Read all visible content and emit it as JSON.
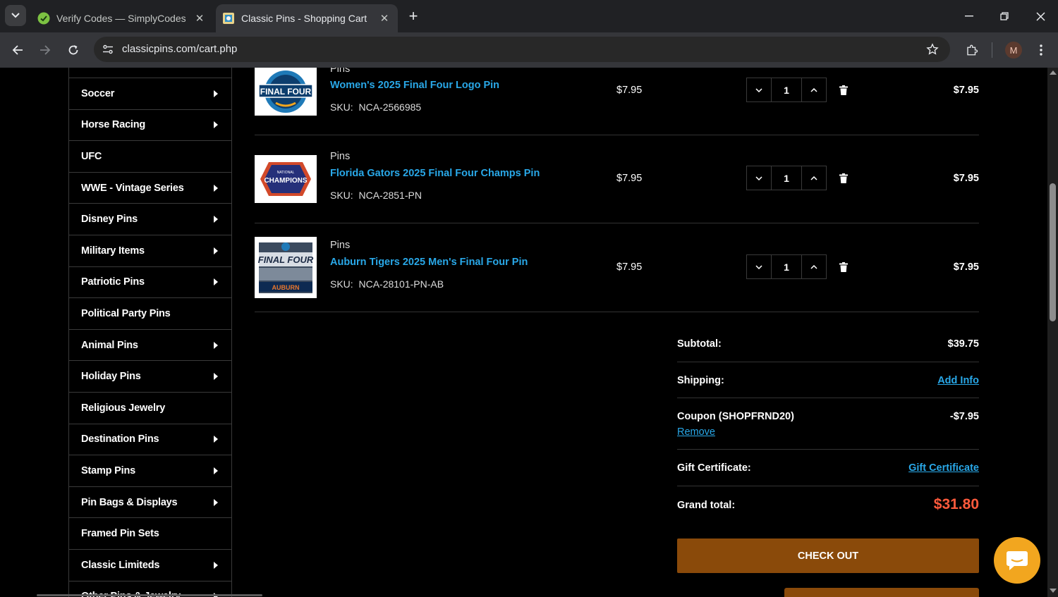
{
  "browser": {
    "tabs": [
      {
        "title": "Verify Codes — SimplyCodes",
        "favicon": "simplycodes-icon",
        "active": false
      },
      {
        "title": "Classic Pins - Shopping Cart",
        "favicon": "classicpins-icon",
        "active": true
      }
    ],
    "url": "classicpins.com/cart.php",
    "profile_initial": "M"
  },
  "sidebar": {
    "items": [
      {
        "label": "Soccer",
        "has_submenu": true
      },
      {
        "label": "Horse Racing",
        "has_submenu": true
      },
      {
        "label": "UFC",
        "has_submenu": false
      },
      {
        "label": "WWE - Vintage Series",
        "has_submenu": true
      },
      {
        "label": "Disney Pins",
        "has_submenu": true
      },
      {
        "label": "Military Items",
        "has_submenu": true
      },
      {
        "label": "Patriotic Pins",
        "has_submenu": true
      },
      {
        "label": "Political Party Pins",
        "has_submenu": false
      },
      {
        "label": "Animal Pins",
        "has_submenu": true
      },
      {
        "label": "Holiday Pins",
        "has_submenu": true
      },
      {
        "label": "Religious Jewelry",
        "has_submenu": false
      },
      {
        "label": "Destination Pins",
        "has_submenu": true
      },
      {
        "label": "Stamp Pins",
        "has_submenu": true
      },
      {
        "label": "Pin Bags & Displays",
        "has_submenu": true
      },
      {
        "label": "Framed Pin Sets",
        "has_submenu": false
      },
      {
        "label": "Classic Limiteds",
        "has_submenu": true
      },
      {
        "label": "Other Pins & Jewelry",
        "has_submenu": true
      }
    ]
  },
  "cart": {
    "items": [
      {
        "category": "Pins",
        "name": "Women's 2025 Final Four Logo Pin",
        "sku_label": "SKU:",
        "sku": "NCA-2566985",
        "price": "$7.95",
        "qty": "1",
        "total": "$7.95"
      },
      {
        "category": "Pins",
        "name": "Florida Gators 2025 Final Four Champs Pin",
        "sku_label": "SKU:",
        "sku": "NCA-2851-PN",
        "price": "$7.95",
        "qty": "1",
        "total": "$7.95"
      },
      {
        "category": "Pins",
        "name": "Auburn Tigers 2025 Men's Final Four Pin",
        "sku_label": "SKU:",
        "sku": "NCA-28101-PN-AB",
        "price": "$7.95",
        "qty": "1",
        "total": "$7.95"
      }
    ]
  },
  "totals": {
    "subtotal_label": "Subtotal:",
    "subtotal": "$39.75",
    "shipping_label": "Shipping:",
    "shipping_link": "Add Info",
    "coupon_label": "Coupon (SHOPFRND20)",
    "coupon_value": "-$7.95",
    "coupon_remove": "Remove",
    "gift_label": "Gift Certificate:",
    "gift_link": "Gift Certificate",
    "grand_label": "Grand total:",
    "grand_total": "$31.80"
  },
  "checkout_label": "CHECK OUT",
  "colors": {
    "link": "#29a8e8",
    "grand_total": "#ff5a3c",
    "checkout_bg": "#8a4a0a",
    "chat_bg": "#f2a61f"
  }
}
